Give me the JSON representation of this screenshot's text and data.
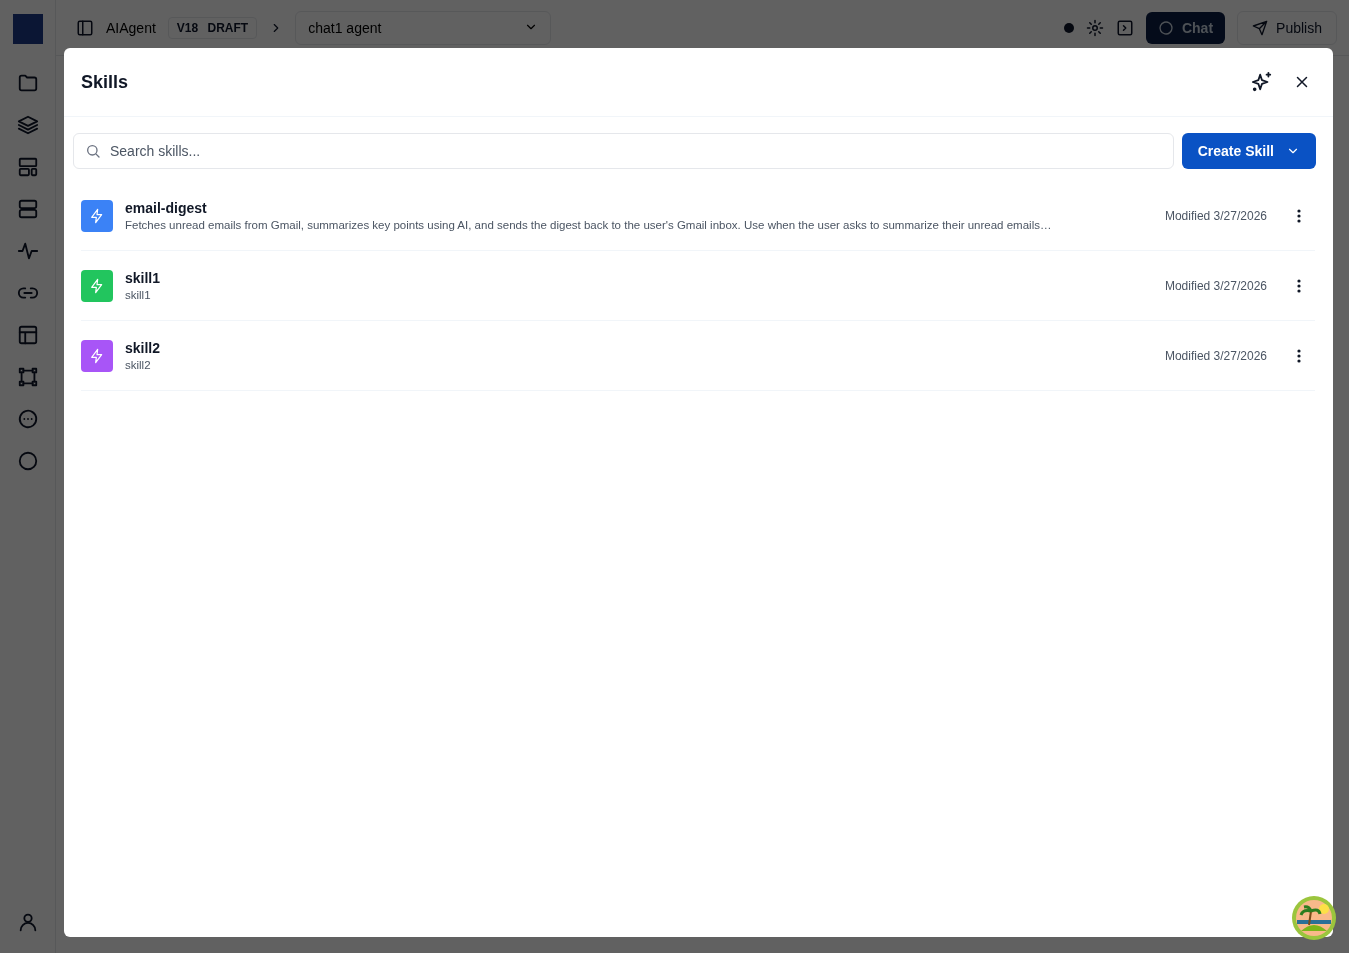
{
  "topbar": {
    "app_name": "AIAgent",
    "version": "V18",
    "status": "DRAFT",
    "agent_select": "chat1 agent",
    "chat_button": "Chat",
    "publish_button": "Publish"
  },
  "dialog": {
    "title": "Skills",
    "search": {
      "placeholder": "Search skills..."
    },
    "create_button": "Create Skill",
    "skills": [
      {
        "name": "email-digest",
        "description": "Fetches unread emails from Gmail, summarizes key points using AI, and sends the digest back to the user's Gmail inbox. Use when the user asks to summarize their unread emails…",
        "modified": "Modified 3/27/2026",
        "color": "#3b82f6"
      },
      {
        "name": "skill1",
        "description": "skill1",
        "modified": "Modified 3/27/2026",
        "color": "#22c55e"
      },
      {
        "name": "skill2",
        "description": "skill2",
        "modified": "Modified 3/27/2026",
        "color": "#a855f7"
      }
    ]
  }
}
